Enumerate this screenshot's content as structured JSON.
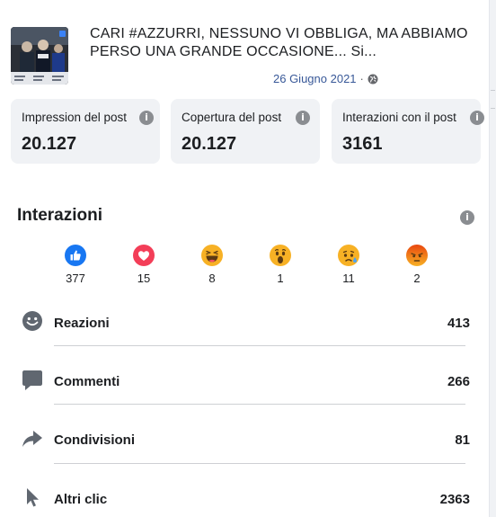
{
  "post": {
    "title": "CARI #AZZURRI, NESSUNO VI OBBLIGA, MA ABBIAMO PERSO UNA GRANDE OCCASIONE... Si...",
    "date": "26 Giugno 2021",
    "separator": "·",
    "privacy_icon": "globe-icon",
    "thumbnail_icon": "post-photo-thumbnail"
  },
  "stats": [
    {
      "label": "Impression del post",
      "value": "20.127",
      "icon": "info-icon"
    },
    {
      "label": "Copertura del post",
      "value": "20.127",
      "icon": "info-icon"
    },
    {
      "label": "Interazioni con il post",
      "value": "3161",
      "icon": "info-icon"
    }
  ],
  "interactions": {
    "title": "Interazioni",
    "info_icon": "info-icon",
    "reactions": [
      {
        "icon": "like-icon",
        "count": "377",
        "color": "#1877f2"
      },
      {
        "icon": "love-icon",
        "count": "15",
        "color": "#f33e58"
      },
      {
        "icon": "haha-icon",
        "count": "8",
        "color": "#f7b125"
      },
      {
        "icon": "wow-icon",
        "count": "1",
        "color": "#f7b125"
      },
      {
        "icon": "sad-icon",
        "count": "11",
        "color": "#f7b125"
      },
      {
        "icon": "angry-icon",
        "count": "2",
        "color": "#e9710f"
      }
    ],
    "metrics": [
      {
        "label": "Reazioni",
        "value": "413",
        "icon": "smiley-icon"
      },
      {
        "label": "Commenti",
        "value": "266",
        "icon": "comment-icon"
      },
      {
        "label": "Condivisioni",
        "value": "81",
        "icon": "share-icon"
      },
      {
        "label": "Altri clic",
        "value": "2363",
        "icon": "cursor-icon"
      }
    ]
  },
  "colors": {
    "card_background": "#f0f2f5",
    "link_blue": "#385898",
    "text": "#1c1e21",
    "secondary_text": "#65676b",
    "icon_gray": "#606770"
  }
}
